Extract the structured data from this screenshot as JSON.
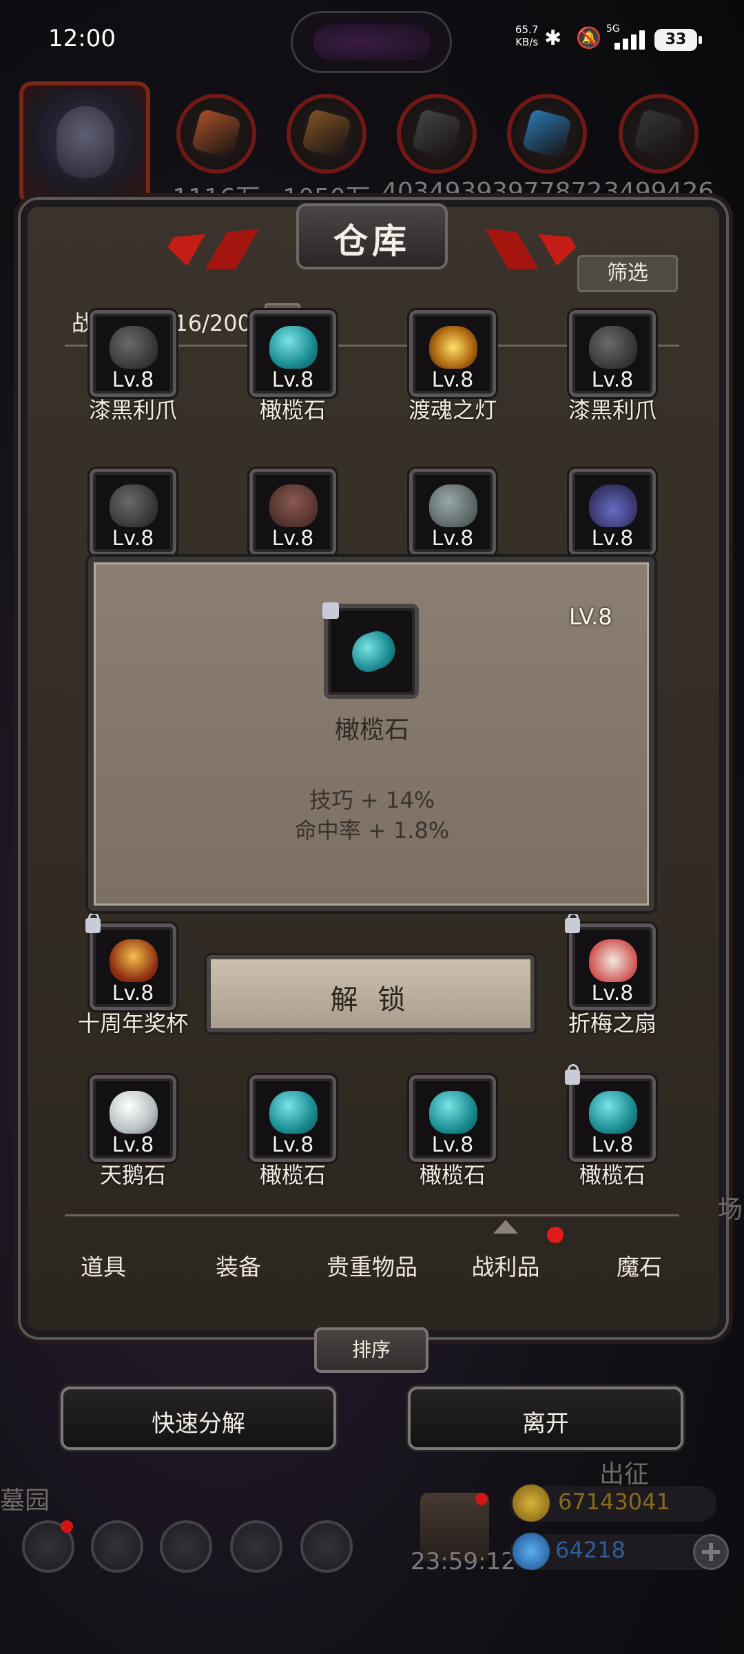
{
  "status_bar": {
    "time": "12:00",
    "net_speed_value": "65.7",
    "net_speed_unit": "KB/s",
    "network_type": "5G",
    "battery": "33"
  },
  "resources": [
    {
      "value": "1116万",
      "color": "#b8592a"
    },
    {
      "value": "1050万",
      "color": "#8c5a28"
    },
    {
      "value": "4034939",
      "color": "#4a4a4a"
    },
    {
      "value": "3977872",
      "color": "#2e86c4"
    },
    {
      "value": "3499426",
      "color": "#3a3a3a"
    }
  ],
  "warehouse": {
    "title": "仓库",
    "filter_label": "筛选",
    "loot_count": "战利品：116/200"
  },
  "items": [
    {
      "name": "漆黑利爪",
      "level": "Lv.8",
      "art": "claw"
    },
    {
      "name": "橄榄石",
      "level": "Lv.8",
      "art": "teal"
    },
    {
      "name": "渡魂之灯",
      "level": "Lv.8",
      "art": "lamp"
    },
    {
      "name": "漆黑利爪",
      "level": "Lv.8",
      "art": "claw"
    },
    {
      "name": "",
      "level": "Lv.8",
      "art": "claw"
    },
    {
      "name": "",
      "level": "Lv.8",
      "art": "scale"
    },
    {
      "name": "",
      "level": "Lv.8",
      "art": "grey"
    },
    {
      "name": "",
      "level": "Lv.8",
      "art": "necklace"
    },
    {
      "name": "十周年奖杯",
      "level": "Lv.8",
      "art": "trophy",
      "locked": true
    },
    {
      "name": "折梅之扇",
      "level": "Lv.8",
      "art": "fan",
      "locked": true
    },
    {
      "name": "天鹅石",
      "level": "Lv.8",
      "art": "white"
    },
    {
      "name": "橄榄石",
      "level": "Lv.8",
      "art": "teal"
    },
    {
      "name": "橄榄石",
      "level": "Lv.8",
      "art": "teal"
    },
    {
      "name": "橄榄石",
      "level": "Lv.8",
      "art": "teal",
      "locked": true
    }
  ],
  "tooltip": {
    "level": "LV.8",
    "name": "橄榄石",
    "stats": [
      "技巧 + 14%",
      "命中率 + 1.8%"
    ],
    "unlock_label": "解 锁"
  },
  "tabs": [
    "道具",
    "装备",
    "贵重物品",
    "战利品",
    "魔石"
  ],
  "active_tab": "战利品",
  "buttons": {
    "sort": "排序",
    "quick_decompose": "快速分解",
    "leave": "离开"
  },
  "hud": {
    "graveyard": "墓园",
    "sortie": "出征",
    "timer": "23:59:12",
    "gold": "67143041",
    "gems": "64218",
    "side_label": "场"
  },
  "colors": {
    "gold": "#c9a22a",
    "gems": "#2f6fb0",
    "notification": "#e21a1a"
  }
}
